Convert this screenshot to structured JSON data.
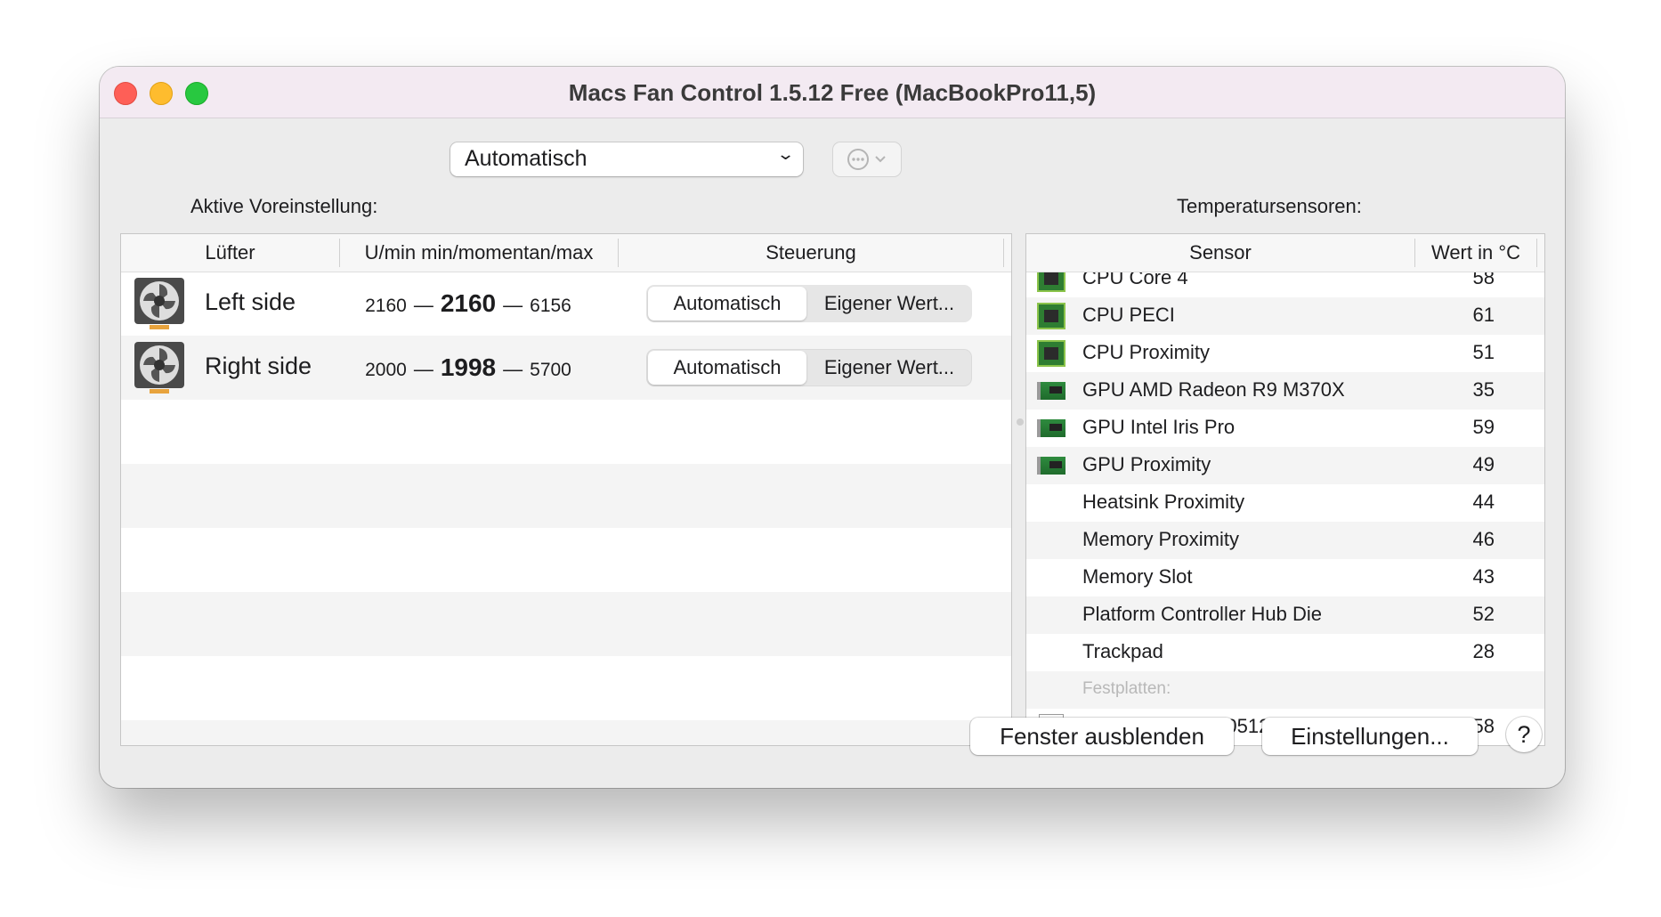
{
  "window": {
    "title": "Macs Fan Control 1.5.12 Free (MacBookPro11,5)"
  },
  "preset": {
    "label": "Aktive Voreinstellung:",
    "value": "Automatisch"
  },
  "fans_table": {
    "headers": [
      "Lüfter",
      "U/min min/momentan/max",
      "Steuerung"
    ],
    "rows": [
      {
        "name": "Left side",
        "min": "2160",
        "current": "2160",
        "max": "6156",
        "btn_auto": "Automatisch",
        "btn_custom": "Eigener Wert...",
        "selected": "Automatisch"
      },
      {
        "name": "Right side",
        "min": "2000",
        "current": "1998",
        "max": "5700",
        "btn_auto": "Automatisch",
        "btn_custom": "Eigener Wert...",
        "selected": "Automatisch"
      }
    ]
  },
  "sensors": {
    "label": "Temperatursensoren:",
    "headers": [
      "Sensor",
      "Wert in °C"
    ],
    "rows": [
      {
        "name": "CPU Core 4",
        "value": "58",
        "icon": "cpu-chip-icon"
      },
      {
        "name": "CPU PECI",
        "value": "61",
        "icon": "cpu-chip-icon"
      },
      {
        "name": "CPU Proximity",
        "value": "51",
        "icon": "cpu-chip-icon"
      },
      {
        "name": "GPU AMD Radeon R9 M370X",
        "value": "35",
        "icon": "gpu-card-icon"
      },
      {
        "name": "GPU Intel Iris Pro",
        "value": "59",
        "icon": "gpu-card-icon"
      },
      {
        "name": "GPU Proximity",
        "value": "49",
        "icon": "gpu-card-icon"
      },
      {
        "name": "Heatsink Proximity",
        "value": "44",
        "icon": ""
      },
      {
        "name": "Memory Proximity",
        "value": "46",
        "icon": ""
      },
      {
        "name": "Memory Slot",
        "value": "43",
        "icon": ""
      },
      {
        "name": "Platform Controller Hub Die",
        "value": "52",
        "icon": ""
      },
      {
        "name": "Trackpad",
        "value": "28",
        "icon": ""
      }
    ],
    "disk_section": "Festplatten:",
    "disks": [
      {
        "name": "APPLE SSD SM0512G",
        "value": "58",
        "icon": "ssd-drive-icon"
      }
    ]
  },
  "footer": {
    "hide_button": "Fenster ausblenden",
    "settings_button": "Einstellungen...",
    "help_button": "?"
  },
  "colors": {
    "close": "#fe5f57",
    "minimize": "#febc2e",
    "maximize": "#28c840",
    "chip": "#2e7d32"
  }
}
